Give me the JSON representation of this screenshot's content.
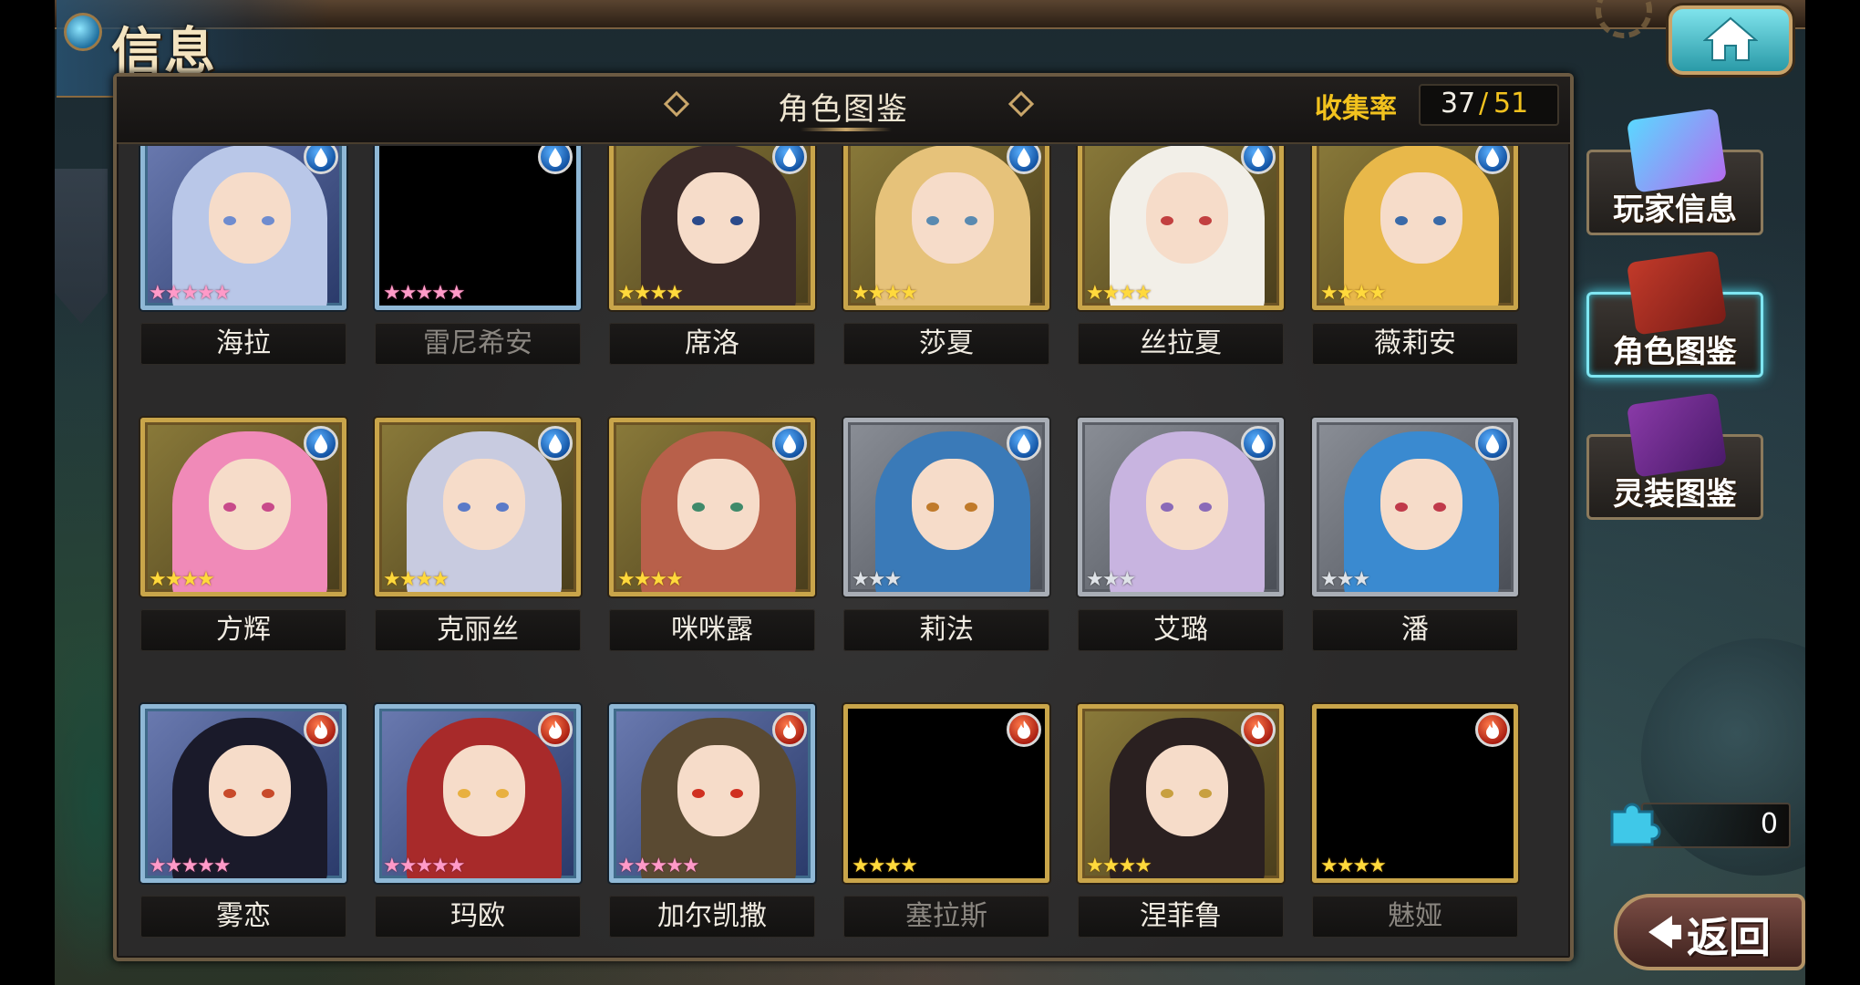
{
  "header": {
    "page_title": "信息",
    "panel_title": "角色图鉴",
    "collection_label": "收集率",
    "collection_current": "37",
    "collection_separator": "/",
    "collection_total": "51"
  },
  "colors": {
    "gold_frame": "#c9a54a",
    "silver_frame": "#a9aeb6",
    "accent_cyan": "#7fe6f2",
    "collection_yellow": "#f2c21e"
  },
  "characters": [
    {
      "name": "海拉",
      "owned": true,
      "element": "water",
      "rarity": 5,
      "frame": "blueframe"
    },
    {
      "name": "雷尼希安",
      "owned": false,
      "element": "water",
      "rarity": 5,
      "frame": "blueframe"
    },
    {
      "name": "席洛",
      "owned": true,
      "element": "water",
      "rarity": 4,
      "frame": "gold"
    },
    {
      "name": "莎夏",
      "owned": true,
      "element": "water",
      "rarity": 4,
      "frame": "gold"
    },
    {
      "name": "丝拉夏",
      "owned": true,
      "element": "water",
      "rarity": 4,
      "frame": "gold"
    },
    {
      "name": "薇莉安",
      "owned": true,
      "element": "water",
      "rarity": 4,
      "frame": "gold"
    },
    {
      "name": "方辉",
      "owned": true,
      "element": "water",
      "rarity": 4,
      "frame": "gold"
    },
    {
      "name": "克丽丝",
      "owned": true,
      "element": "water",
      "rarity": 4,
      "frame": "gold"
    },
    {
      "name": "咪咪露",
      "owned": true,
      "element": "water",
      "rarity": 4,
      "frame": "gold"
    },
    {
      "name": "莉法",
      "owned": true,
      "element": "water",
      "rarity": 3,
      "frame": "silver"
    },
    {
      "name": "艾璐",
      "owned": true,
      "element": "water",
      "rarity": 3,
      "frame": "silver"
    },
    {
      "name": "潘",
      "owned": true,
      "element": "water",
      "rarity": 3,
      "frame": "silver"
    },
    {
      "name": "雾恋",
      "owned": true,
      "element": "fire",
      "rarity": 5,
      "frame": "blueframe"
    },
    {
      "name": "玛欧",
      "owned": true,
      "element": "fire",
      "rarity": 5,
      "frame": "blueframe"
    },
    {
      "name": "加尔凯撒",
      "owned": true,
      "element": "fire",
      "rarity": 5,
      "frame": "blueframe"
    },
    {
      "name": "塞拉斯",
      "owned": false,
      "element": "fire",
      "rarity": 4,
      "frame": "gold"
    },
    {
      "name": "涅菲鲁",
      "owned": true,
      "element": "fire",
      "rarity": 4,
      "frame": "gold"
    },
    {
      "name": "魅娅",
      "owned": false,
      "element": "fire",
      "rarity": 4,
      "frame": "gold"
    }
  ],
  "side_menu": [
    {
      "label": "玩家信息",
      "icon": "player-card-icon",
      "active": false
    },
    {
      "label": "角色图鉴",
      "icon": "character-book-icon",
      "active": true
    },
    {
      "label": "灵装图鉴",
      "icon": "equipment-book-icon",
      "active": false
    }
  ],
  "currency": {
    "icon": "puzzle-piece-icon",
    "value": "0"
  },
  "back_button": {
    "label": "返回"
  },
  "home_button": {
    "icon": "home-icon"
  }
}
